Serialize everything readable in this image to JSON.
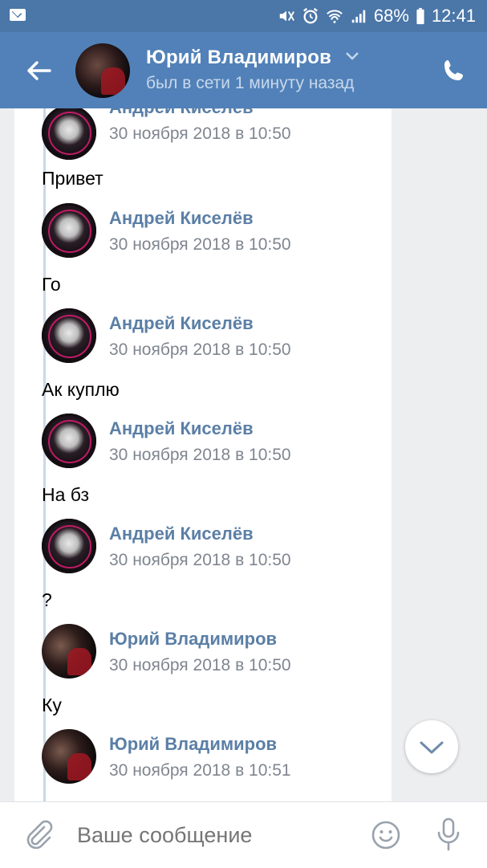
{
  "status_bar": {
    "battery": "68%",
    "time": "12:41"
  },
  "header": {
    "name": "Юрий Владимиров",
    "status": "был в сети 1 минуту назад"
  },
  "messages": [
    {
      "author": "Андрей Киселёв",
      "time": "30 ноября 2018 в 10:50",
      "text": "Привет",
      "avatar": "andrey"
    },
    {
      "author": "Андрей Киселёв",
      "time": "30 ноября 2018 в 10:50",
      "text": "Го",
      "avatar": "andrey"
    },
    {
      "author": "Андрей Киселёв",
      "time": "30 ноября 2018 в 10:50",
      "text": "Ак куплю",
      "avatar": "andrey"
    },
    {
      "author": "Андрей Киселёв",
      "time": "30 ноября 2018 в 10:50",
      "text": "На бз",
      "avatar": "andrey"
    },
    {
      "author": "Андрей Киселёв",
      "time": "30 ноября 2018 в 10:50",
      "text": "?",
      "avatar": "andrey"
    },
    {
      "author": "Юрий Владимиров",
      "time": "30 ноября 2018 в 10:50",
      "text": "Ку",
      "avatar": "yuri"
    },
    {
      "author": "Юрий Владимиров",
      "time": "30 ноября 2018 в 10:51",
      "text": "",
      "avatar": "yuri"
    }
  ],
  "composer": {
    "placeholder": "Ваше сообщение"
  },
  "colors": {
    "header_bg": "#5181b8",
    "status_bar_bg": "#4a76a8",
    "author_link": "#5b7fa6"
  }
}
